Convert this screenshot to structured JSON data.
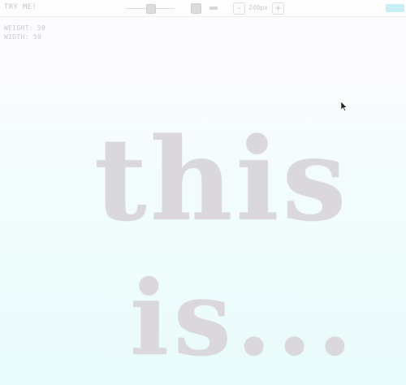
{
  "toolbar": {
    "try_label": "TRY ME!",
    "slider_icon": "slider-thumb",
    "square_icon": "square-icon",
    "dash_icon": "dash-icon",
    "minus_label": "-",
    "size_readout": "240px",
    "plus_label": "+",
    "accent_color": "#c9eff6"
  },
  "axes": {
    "weight": "WEIGHT: 50",
    "width": "WIDTH: 50"
  },
  "preview": {
    "line1": "this",
    "line2": "is..."
  }
}
